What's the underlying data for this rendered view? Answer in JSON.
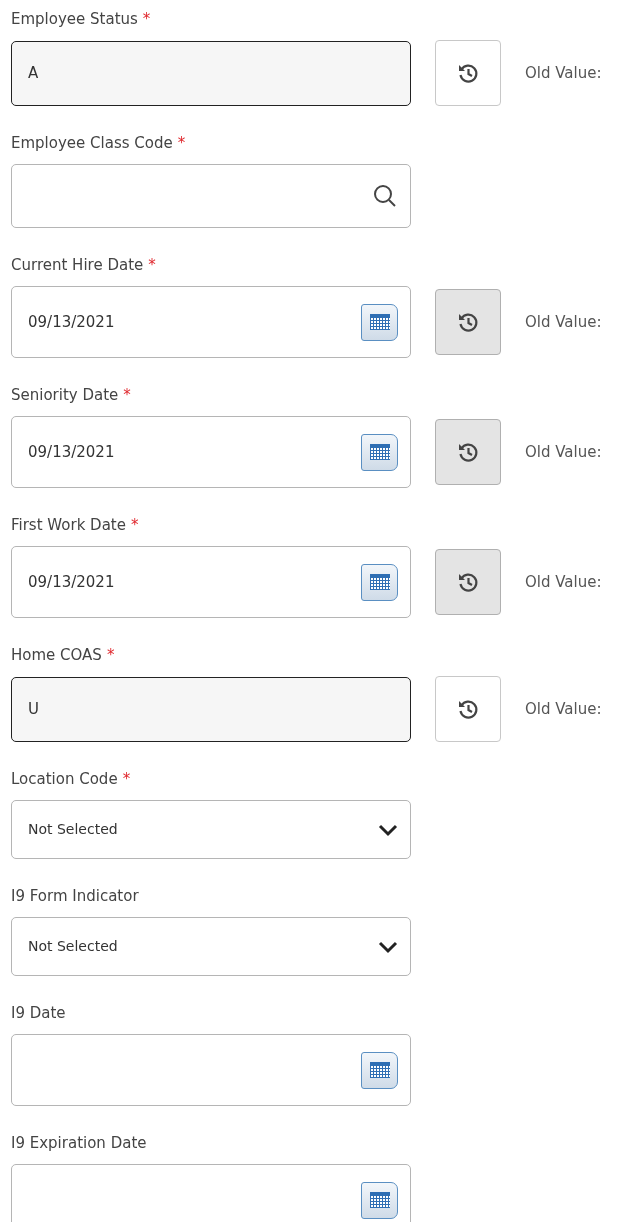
{
  "fields": [
    {
      "label": "Employee Status",
      "required_mark": "*",
      "kind": "readonly",
      "value": "A",
      "history": {
        "disabled": false,
        "text": "Old Value:"
      }
    },
    {
      "label": "Employee Class Code",
      "required_mark": "*",
      "kind": "lookup"
    },
    {
      "label": "Current Hire Date",
      "required_mark": "*",
      "kind": "date",
      "value": "09/13/2021",
      "history": {
        "disabled": true,
        "text": "Old Value:"
      }
    },
    {
      "label": "Seniority Date",
      "required_mark": "*",
      "kind": "date",
      "value": "09/13/2021",
      "history": {
        "disabled": true,
        "text": "Old Value:"
      }
    },
    {
      "label": "First Work Date",
      "required_mark": "*",
      "kind": "date",
      "value": "09/13/2021",
      "history": {
        "disabled": true,
        "text": "Old Value:"
      }
    },
    {
      "label": "Home COAS",
      "required_mark": "*",
      "kind": "readonly",
      "value": "U",
      "history": {
        "disabled": false,
        "text": "Old Value:"
      }
    },
    {
      "label": "Location Code",
      "required_mark": "*",
      "kind": "select",
      "value": "Not Selected"
    },
    {
      "label": "I9 Form Indicator",
      "kind": "select",
      "value": "Not Selected"
    },
    {
      "label": "I9 Date",
      "kind": "date"
    },
    {
      "label": "I9 Expiration Date",
      "kind": "date"
    }
  ]
}
